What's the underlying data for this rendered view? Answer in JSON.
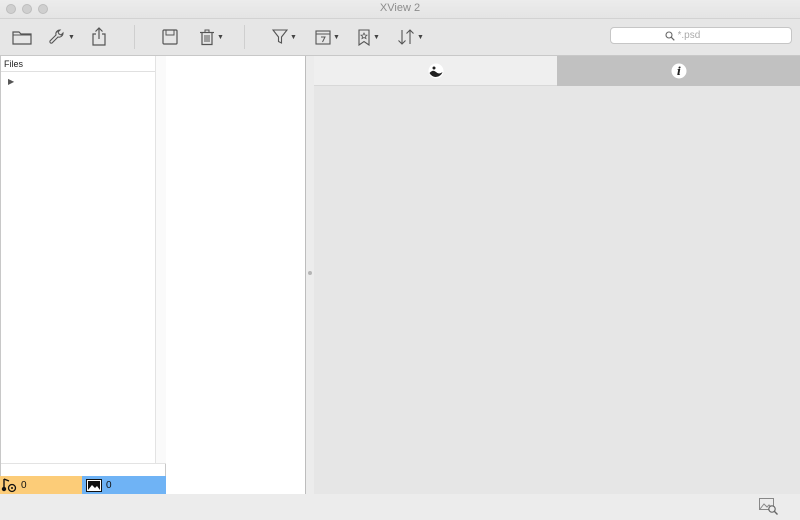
{
  "window": {
    "title": "XView 2"
  },
  "toolbar": {
    "buttons": [
      {
        "name": "open-folder",
        "icon": "folder-icon"
      },
      {
        "name": "tools",
        "icon": "wrench-icon",
        "dropdown": true
      },
      {
        "name": "share",
        "icon": "share-icon"
      },
      {
        "name": "save",
        "icon": "floppy-icon"
      },
      {
        "name": "delete",
        "icon": "trash-icon",
        "dropdown": true
      },
      {
        "name": "filter",
        "icon": "funnel-icon",
        "dropdown": true
      },
      {
        "name": "calendar",
        "icon": "calendar-icon",
        "dropdown": true
      },
      {
        "name": "bookmark",
        "icon": "bookmark-icon",
        "dropdown": true
      },
      {
        "name": "sort",
        "icon": "sort-icon",
        "dropdown": true
      }
    ],
    "search": {
      "placeholder": "*.psd",
      "value": ""
    }
  },
  "files_panel": {
    "header": "Files"
  },
  "counters": {
    "audio": {
      "count": "0",
      "color": "#fccc78",
      "icon": "audio-video-icon"
    },
    "images": {
      "count": "0",
      "color": "#6fb3f5",
      "icon": "image-icon"
    }
  },
  "tabs": [
    {
      "name": "preview",
      "icon": "image-preview-icon",
      "active": false
    },
    {
      "name": "info",
      "icon": "info-icon",
      "active": true
    }
  ],
  "footer": {
    "icon": "image-search-icon"
  }
}
